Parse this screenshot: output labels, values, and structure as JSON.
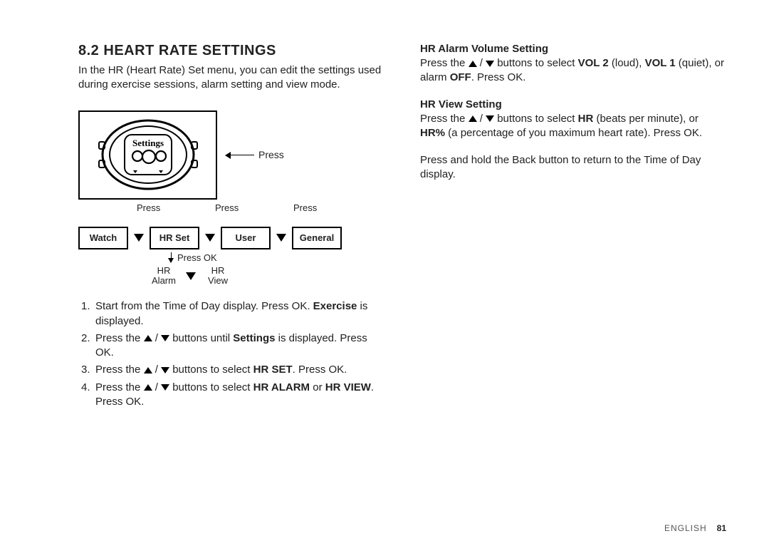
{
  "section": {
    "number": "8.2",
    "title": "HEART RATE SETTINGS",
    "intro": "In the HR (Heart Rate) Set menu, you can edit the settings used during exercise sessions, alarm setting and view mode."
  },
  "diagram": {
    "watch_label": "Settings",
    "press_label": "Press",
    "nav_press_labels": [
      "Press",
      "Press",
      "Press"
    ],
    "nav_boxes": [
      "Watch",
      "HR Set",
      "User",
      "General"
    ],
    "press_ok_label": "Press OK",
    "hr_sub": [
      "HR\nAlarm",
      "HR\nView"
    ]
  },
  "steps": [
    {
      "num": "1.",
      "pre": "Start from the Time of Day display. Press OK. ",
      "bold": "Exercise",
      "post": " is displayed."
    },
    {
      "num": "2.",
      "pre": "Press the ",
      "arrows": true,
      "mid": " buttons until ",
      "bold": "Settings",
      "post": " is displayed. Press OK."
    },
    {
      "num": "3.",
      "pre": "Press the ",
      "arrows": true,
      "mid": " buttons to select ",
      "bold": "HR SET",
      "post": ". Press OK."
    },
    {
      "num": "4.",
      "pre": "Press the ",
      "arrows": true,
      "mid": " buttons to select ",
      "bold": "HR ALARM",
      "post_mid": " or ",
      "bold2": "HR VIEW",
      "post": ". Press OK."
    }
  ],
  "right_col": {
    "alarm_volume": {
      "heading": "HR Alarm Volume Setting",
      "pre": "Press the ",
      "mid": " buttons to select ",
      "b1": "VOL 2",
      "t1": " (loud), ",
      "b2": "VOL 1",
      "t2": " (quiet), or alarm ",
      "b3": "OFF",
      "t3": ". Press OK."
    },
    "view": {
      "heading": "HR View Setting",
      "pre": "Press the ",
      "mid": " buttons to select ",
      "b1": "HR",
      "t1": " (beats per minute), or ",
      "b2": "HR%",
      "t2": " (a percentage of you maximum heart rate). Press OK."
    },
    "return": "Press and hold the Back button to return to the Time of Day display."
  },
  "footer": {
    "lang": "ENGLISH",
    "page": "81"
  }
}
